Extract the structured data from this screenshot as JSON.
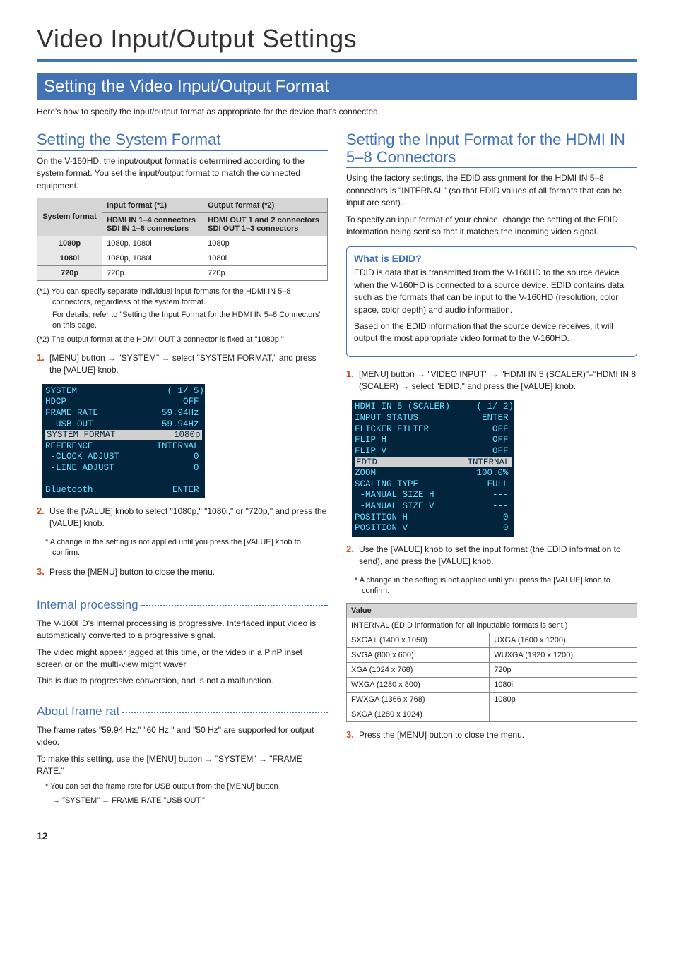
{
  "chapter_title": "Video Input/Output Settings",
  "h1": "Setting the Video Input/Output Format",
  "intro": "Here's how to specify the input/output format as appropriate for the device that's connected.",
  "left": {
    "h2": "Setting the System Format",
    "p1": "On the V-160HD, the input/output format is determined according to the system format. You set the input/output format to match the connected equipment.",
    "table": {
      "h_system": "System format",
      "h_input": "Input format (*1)",
      "h_input_sub": "HDMI IN 1–4 connectors\nSDI IN 1–8 connectors",
      "h_output": "Output format (*2)",
      "h_output_sub": "HDMI OUT 1 and 2 connectors\nSDI OUT 1–3 connectors",
      "rows": [
        {
          "sys": "1080p",
          "in": "1080p, 1080i",
          "out": "1080p"
        },
        {
          "sys": "1080i",
          "in": "1080p, 1080i",
          "out": "1080i"
        },
        {
          "sys": "720p",
          "in": "720p",
          "out": "720p"
        }
      ]
    },
    "note1a": "(*1) You can specify separate individual input formats for the HDMI IN 5–8 connectors, regardless of the system format.",
    "note1b": "For details, refer to \"Setting the Input Format for the HDMI IN 5–8 Connectors\" on this page.",
    "note2": "(*2) The output format at the HDMI OUT 3 connector is fixed at \"1080p.\"",
    "step1": "[MENU] button → \"SYSTEM\" → select \"SYSTEM FORMAT,\" and press the [VALUE] knob.",
    "lcd1": "SYSTEM                 ( 1/ 5)\nHDCP                      OFF\nFRAME RATE            59.94Hz\n -USB OUT             59.94Hz",
    "lcd1_sel_left": "SYSTEM FORMAT",
    "lcd1_sel_right": "1080p",
    "lcd1b": "REFERENCE            INTERNAL\n -CLOCK ADJUST              0\n -LINE ADJUST               0\n\nBluetooth               ENTER",
    "step2": "Use the [VALUE] knob to select \"1080p,\" \"1080i,\" or \"720p,\" and press the [VALUE] knob.",
    "step2_note": "* A change in the setting is not applied until you press the [VALUE] knob to confirm.",
    "step3": "Press the [MENU] button to close the menu.",
    "h3a": "Internal processing",
    "ip1": "The V-160HD's internal processing is progressive. Interlaced input video is automatically converted to a progressive signal.",
    "ip2": "The video might appear jagged at this time, or the video in a PinP inset screen or on the multi-view might waver.",
    "ip3": "This is due to progressive conversion, and is not a malfunction.",
    "h3b": "About frame rat",
    "fr1": "The frame rates \"59.94 Hz,\" \"60 Hz,\" and \"50 Hz\" are supported for output video.",
    "fr2": "To make this setting, use the [MENU] button → \"SYSTEM\" → \"FRAME RATE.\"",
    "fr3a": "* You can set the frame rate for USB output from the [MENU] button",
    "fr3b": "→ \"SYSTEM\" → FRAME RATE \"USB OUT.\""
  },
  "right": {
    "h2": "Setting the Input Format for the HDMI IN 5–8 Connectors",
    "p1": "Using the factory settings, the EDID assignment for the HDMI IN 5–8 connectors is \"INTERNAL\" (so that EDID values of all formats that can be input are sent).",
    "p2": "To specify an input format of your choice, change the setting of the EDID information being sent so that it matches the incoming video signal.",
    "callout": {
      "title": "What is EDID?",
      "p1": "EDID is data that is transmitted from the V-160HD to the source device when the V-160HD is connected to a source device. EDID contains data such as the formats that can be input to the V-160HD (resolution, color space, color depth) and audio information.",
      "p2": "Based on the EDID information that the source device receives, it will output the most appropriate video format to the V-160HD."
    },
    "step1": "[MENU] button → \"VIDEO INPUT\" → \"HDMI IN 5 (SCALER)\"–\"HDMI IN 8 (SCALER) → select \"EDID,\" and press the [VALUE] knob.",
    "lcd_top": "HDMI IN 5 (SCALER)     ( 1/ 2)\nINPUT STATUS            ENTER\nFLICKER FILTER            OFF\nFLIP H                    OFF\nFLIP V                    OFF",
    "lcd_sel_left": "EDID",
    "lcd_sel_right": "INTERNAL",
    "lcd_bot": "ZOOM                   100.0%\nSCALING TYPE             FULL\n -MANUAL SIZE H           ---\n -MANUAL SIZE V           ---\nPOSITION H                  0\nPOSITION V                  0",
    "step2": "Use the [VALUE] knob to set the input format (the EDID information to send), and press the [VALUE] knob.",
    "step2_note": "* A change in the setting is not applied until you press the [VALUE] knob to confirm.",
    "value_head": "Value",
    "value_span": "INTERNAL (EDID information for all inputtable formats is sent.)",
    "value_rows": [
      [
        "SXGA+ (1400 x 1050)",
        "UXGA (1600 x 1200)"
      ],
      [
        "SVGA (800 x 600)",
        "WUXGA (1920 x 1200)"
      ],
      [
        "XGA (1024 x 768)",
        "720p"
      ],
      [
        "WXGA (1280 x 800)",
        "1080i"
      ],
      [
        "FWXGA (1366 x 768)",
        "1080p"
      ],
      [
        "SXGA (1280 x 1024)",
        ""
      ]
    ],
    "step3": "Press the [MENU] button to close the menu."
  },
  "pgnum": "12"
}
